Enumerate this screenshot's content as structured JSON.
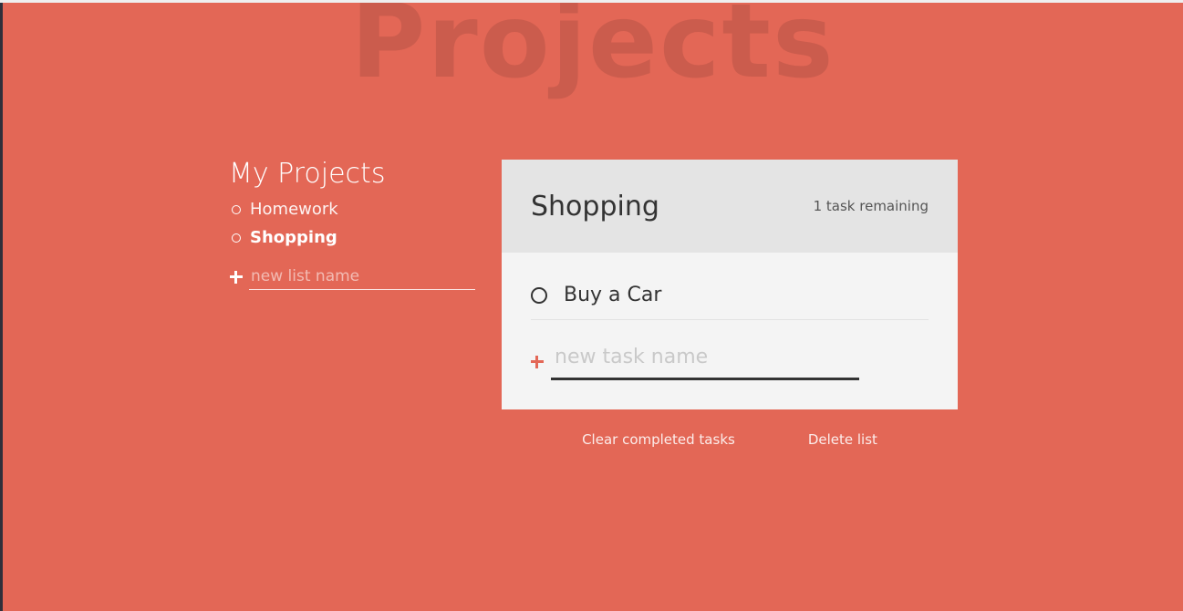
{
  "app": {
    "title_watermark": "Projects",
    "accent_color": "#e36756"
  },
  "sidebar": {
    "title": "My Projects",
    "items": [
      {
        "label": "Homework",
        "active": false
      },
      {
        "label": "Shopping",
        "active": true
      }
    ],
    "new_list_placeholder": "new list name"
  },
  "panel": {
    "list_title": "Shopping",
    "task_count": "1 task remaining",
    "tasks": [
      {
        "label": "Buy a Car",
        "completed": false
      }
    ],
    "new_task_placeholder": "new task name"
  },
  "actions": {
    "clear_completed": "Clear completed tasks",
    "delete_list": "Delete list"
  },
  "icons": {
    "add_list": "plus-icon",
    "add_task": "plus-icon",
    "task_checkbox": "circle-icon",
    "bullet": "circle-icon"
  }
}
